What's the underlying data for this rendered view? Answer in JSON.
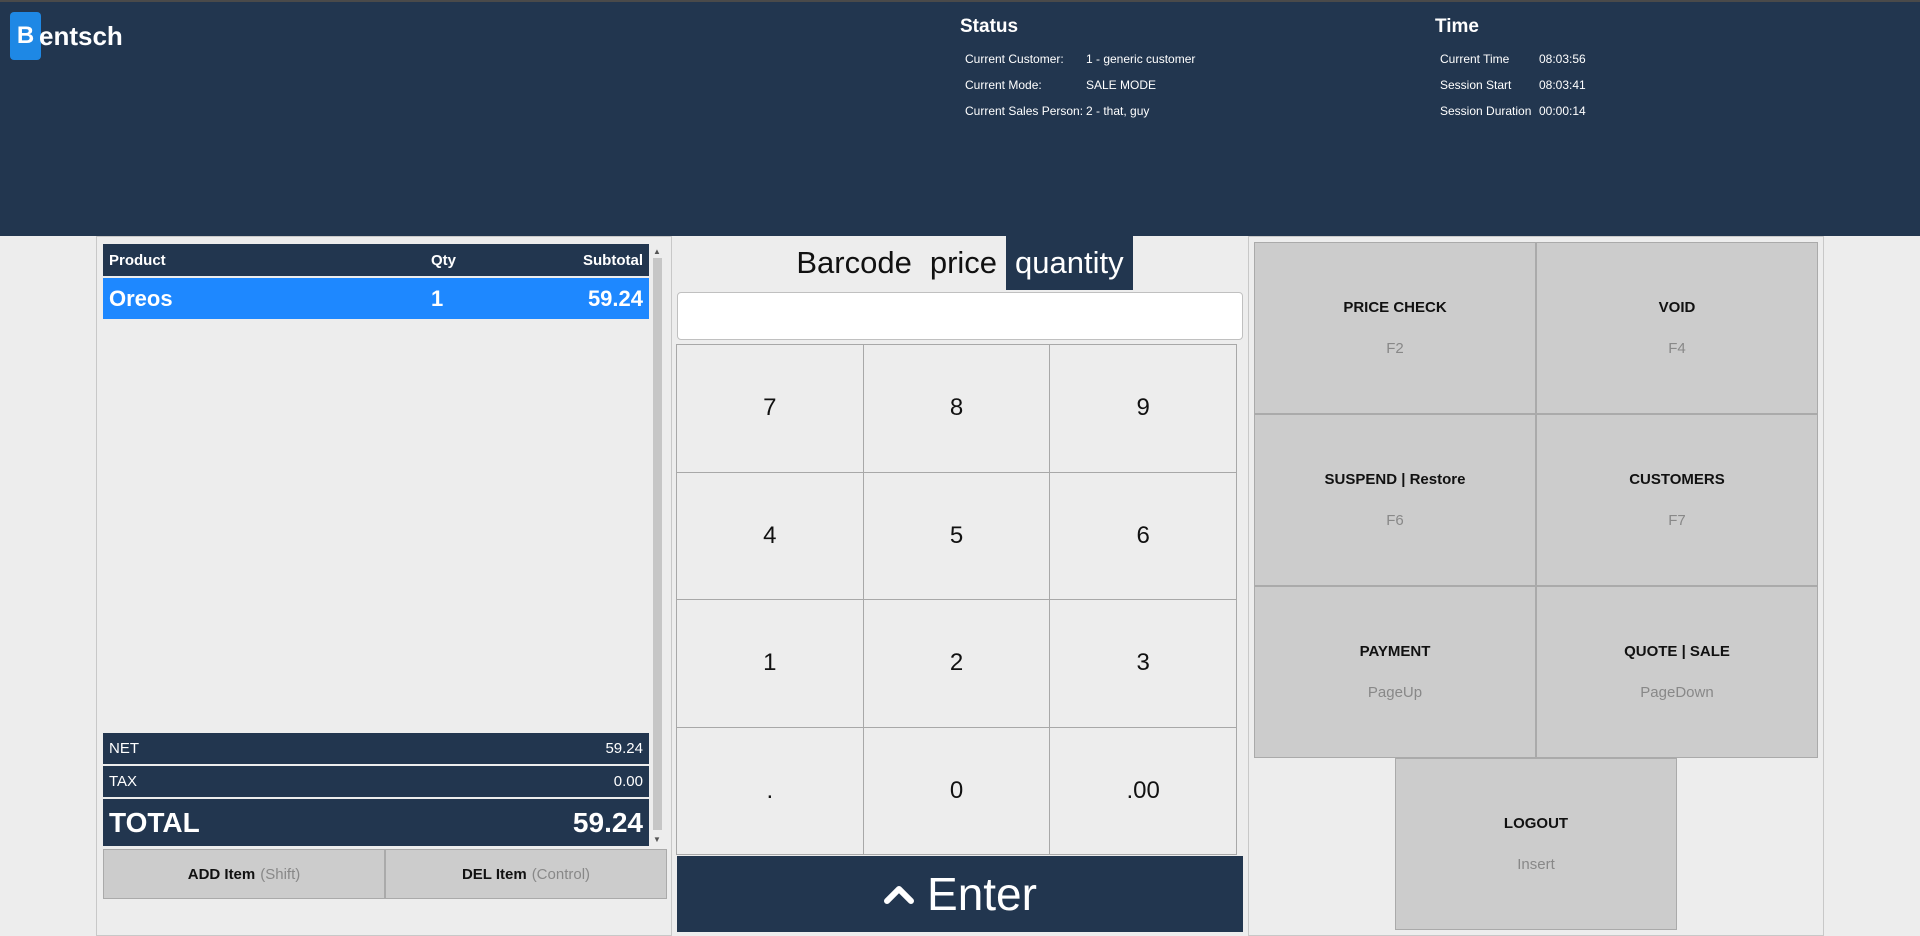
{
  "app": {
    "logo_letter": "B",
    "logo_rest": "entsch"
  },
  "status": {
    "title": "Status",
    "rows": [
      {
        "label": "Current Customer:",
        "value": "1 - generic customer"
      },
      {
        "label": "Current Mode:",
        "value": "SALE MODE"
      },
      {
        "label": "Current Sales Person:",
        "value": "2 - that, guy"
      }
    ]
  },
  "time": {
    "title": "Time",
    "rows": [
      {
        "label": "Current Time",
        "value": "08:03:56"
      },
      {
        "label": "Session Start",
        "value": "08:03:41"
      },
      {
        "label": "Session Duration",
        "value": "00:00:14"
      }
    ]
  },
  "cart": {
    "headers": {
      "product": "Product",
      "qty": "Qty",
      "subtotal": "Subtotal"
    },
    "items": [
      {
        "product": "Oreos",
        "qty": "1",
        "subtotal": "59.24"
      }
    ],
    "net_label": "NET",
    "net": "59.24",
    "tax_label": "TAX",
    "tax": "0.00",
    "total_label": "TOTAL",
    "total": "59.24",
    "add_label": "ADD Item",
    "add_hint": "(Shift)",
    "del_label": "DEL Item",
    "del_hint": "(Control)"
  },
  "entry": {
    "tabs": [
      "Barcode",
      "price",
      "quantity"
    ],
    "active_tab": "quantity",
    "value": "",
    "keys": [
      "7",
      "8",
      "9",
      "4",
      "5",
      "6",
      "1",
      "2",
      "3",
      ".",
      "0",
      ".00"
    ],
    "enter_label": "Enter"
  },
  "functions": [
    {
      "title": "PRICE CHECK",
      "key": "F2"
    },
    {
      "title": "VOID",
      "key": "F4"
    },
    {
      "title": "SUSPEND | Restore",
      "key": "F6"
    },
    {
      "title": "CUSTOMERS",
      "key": "F7"
    },
    {
      "title": "PAYMENT",
      "key": "PageUp"
    },
    {
      "title": "QUOTE | SALE",
      "key": "PageDown"
    },
    {
      "title": "LOGOUT",
      "key": "Insert"
    }
  ],
  "colors": {
    "header_bg": "#22364f",
    "accent": "#1e88ff",
    "button_bg": "#cccccc"
  }
}
